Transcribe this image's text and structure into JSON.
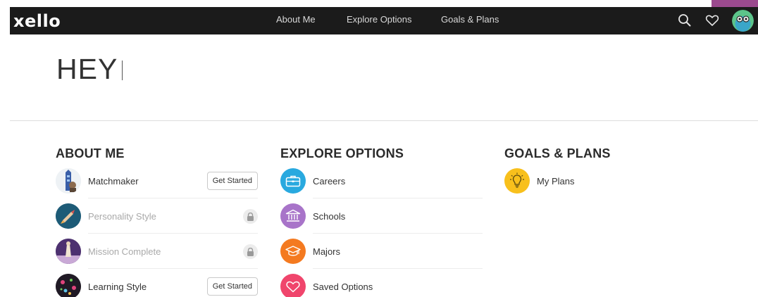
{
  "brand": {
    "logo": "xello"
  },
  "nav": {
    "links": [
      "About Me",
      "Explore Options",
      "Goals & Plans"
    ],
    "icons": [
      "search-icon",
      "heart-icon",
      "avatar"
    ]
  },
  "greeting": "HEY",
  "colors": {
    "navbar": "#1b1b1b",
    "corner_tab": "#9b4a8e",
    "careers": "#29a9df",
    "schools": "#a874c9",
    "majors": "#f47a20",
    "saved": "#f0456c",
    "plans": "#f8c01c"
  },
  "sections": {
    "about_me": {
      "title": "ABOUT ME",
      "items": [
        {
          "label": "Matchmaker",
          "action": "Get Started",
          "locked": false
        },
        {
          "label": "Personality Style",
          "action": "",
          "locked": true
        },
        {
          "label": "Mission Complete",
          "action": "",
          "locked": true
        },
        {
          "label": "Learning Style",
          "action": "Get Started",
          "locked": false
        }
      ]
    },
    "explore_options": {
      "title": "EXPLORE OPTIONS",
      "items": [
        {
          "label": "Careers",
          "icon": "briefcase-icon"
        },
        {
          "label": "Schools",
          "icon": "school-building-icon"
        },
        {
          "label": "Majors",
          "icon": "graduation-cap-icon"
        },
        {
          "label": "Saved Options",
          "icon": "heart-icon"
        }
      ]
    },
    "goals_plans": {
      "title": "GOALS & PLANS",
      "items": [
        {
          "label": "My Plans",
          "icon": "lightbulb-icon"
        }
      ]
    }
  }
}
